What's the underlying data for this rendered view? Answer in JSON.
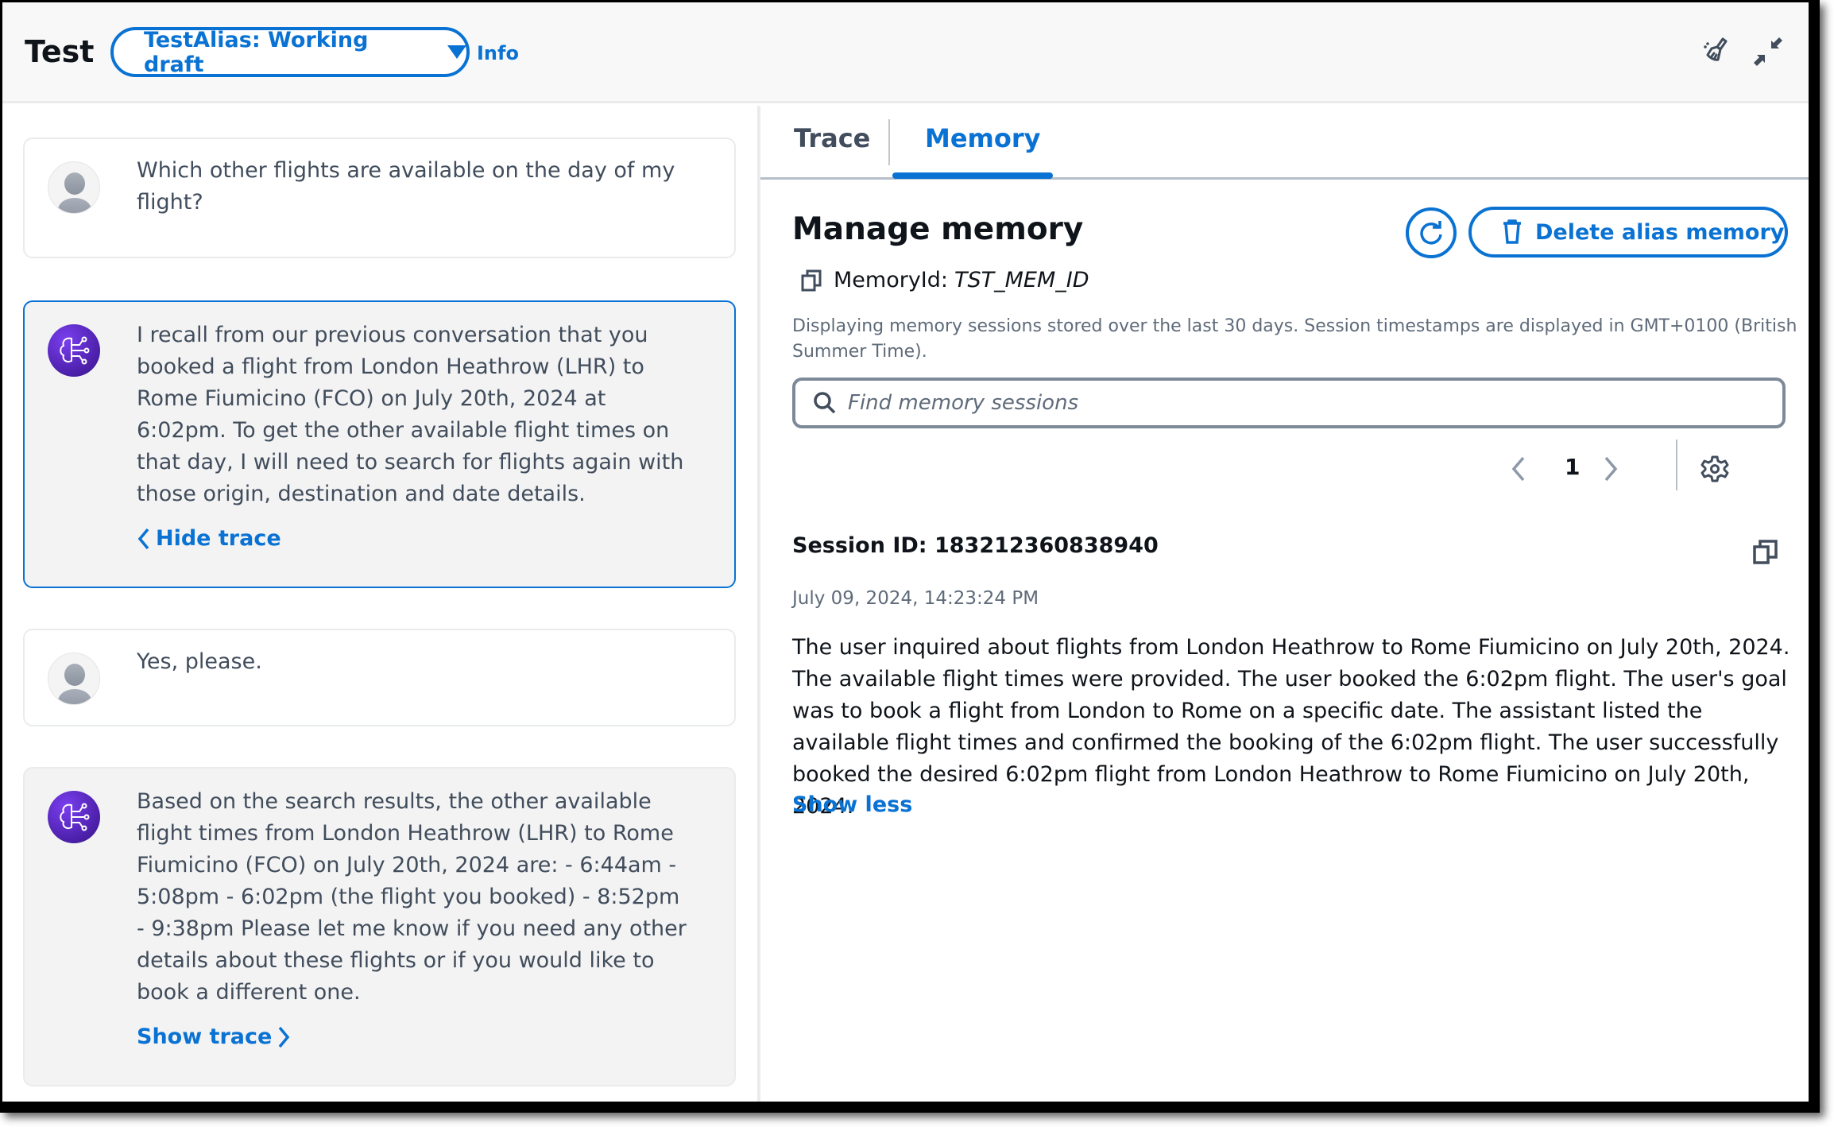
{
  "header": {
    "title": "Test",
    "alias_dropdown": "TestAlias: Working draft",
    "info_link": "Info",
    "icons": [
      "broom-clear-icon",
      "shrink-collapse-icon"
    ]
  },
  "chat": {
    "messages": [
      {
        "role": "user",
        "text": "Which other flights are available on the day of my flight?"
      },
      {
        "role": "agent",
        "text": "I recall from our previous conversation that you booked a flight from London Heathrow (LHR) to Rome Fiumicino (FCO) on July 20th, 2024 at 6:02pm. To get the other available flight times on that day, I will need to search for flights again with those origin, destination and date details.",
        "trace_link": "Hide trace"
      },
      {
        "role": "user",
        "text": "Yes, please."
      },
      {
        "role": "agent",
        "text": "Based on the search results, the other available flight times from London Heathrow (LHR) to Rome Fiumicino (FCO) on July 20th, 2024 are: - 6:44am - 5:08pm - 6:02pm (the flight you booked) - 8:52pm - 9:38pm Please let me know if you need any other details about these flights or if you would like to book a different one.",
        "trace_link": "Show trace"
      }
    ]
  },
  "panel": {
    "tabs": [
      {
        "label": "Trace",
        "active": false
      },
      {
        "label": "Memory",
        "active": true
      }
    ],
    "title": "Manage memory",
    "delete_button": "Delete alias memory",
    "memory_id_label": "MemoryId:",
    "memory_id_value": "TST_MEM_ID",
    "description": "Displaying memory sessions stored over the last 30 days. Session timestamps are displayed in GMT+0100 (British Summer Time).",
    "search_placeholder": "Find memory sessions",
    "search_value": "",
    "current_page": "1",
    "session": {
      "id_label": "Session ID: 183212360838940",
      "timestamp": "July 09, 2024, 14:23:24 PM",
      "summary": "The user inquired about flights from London Heathrow to Rome Fiumicino on July 20th, 2024. The available flight times were provided. The user booked the 6:02pm flight. The user's goal was to book a flight from London to Rome on a specific date. The assistant listed the available flight times and confirmed the booking of the 6:02pm flight. The user successfully booked the desired 6:02pm flight from London Heathrow to Rome Fiumicino on July 20th, 2024.",
      "toggle_link": "Show less"
    }
  },
  "colors": {
    "accent": "#0972d3",
    "text": "#0f141a",
    "muted": "#5f6b7a",
    "agent_avatar": "#5a2bd1"
  }
}
